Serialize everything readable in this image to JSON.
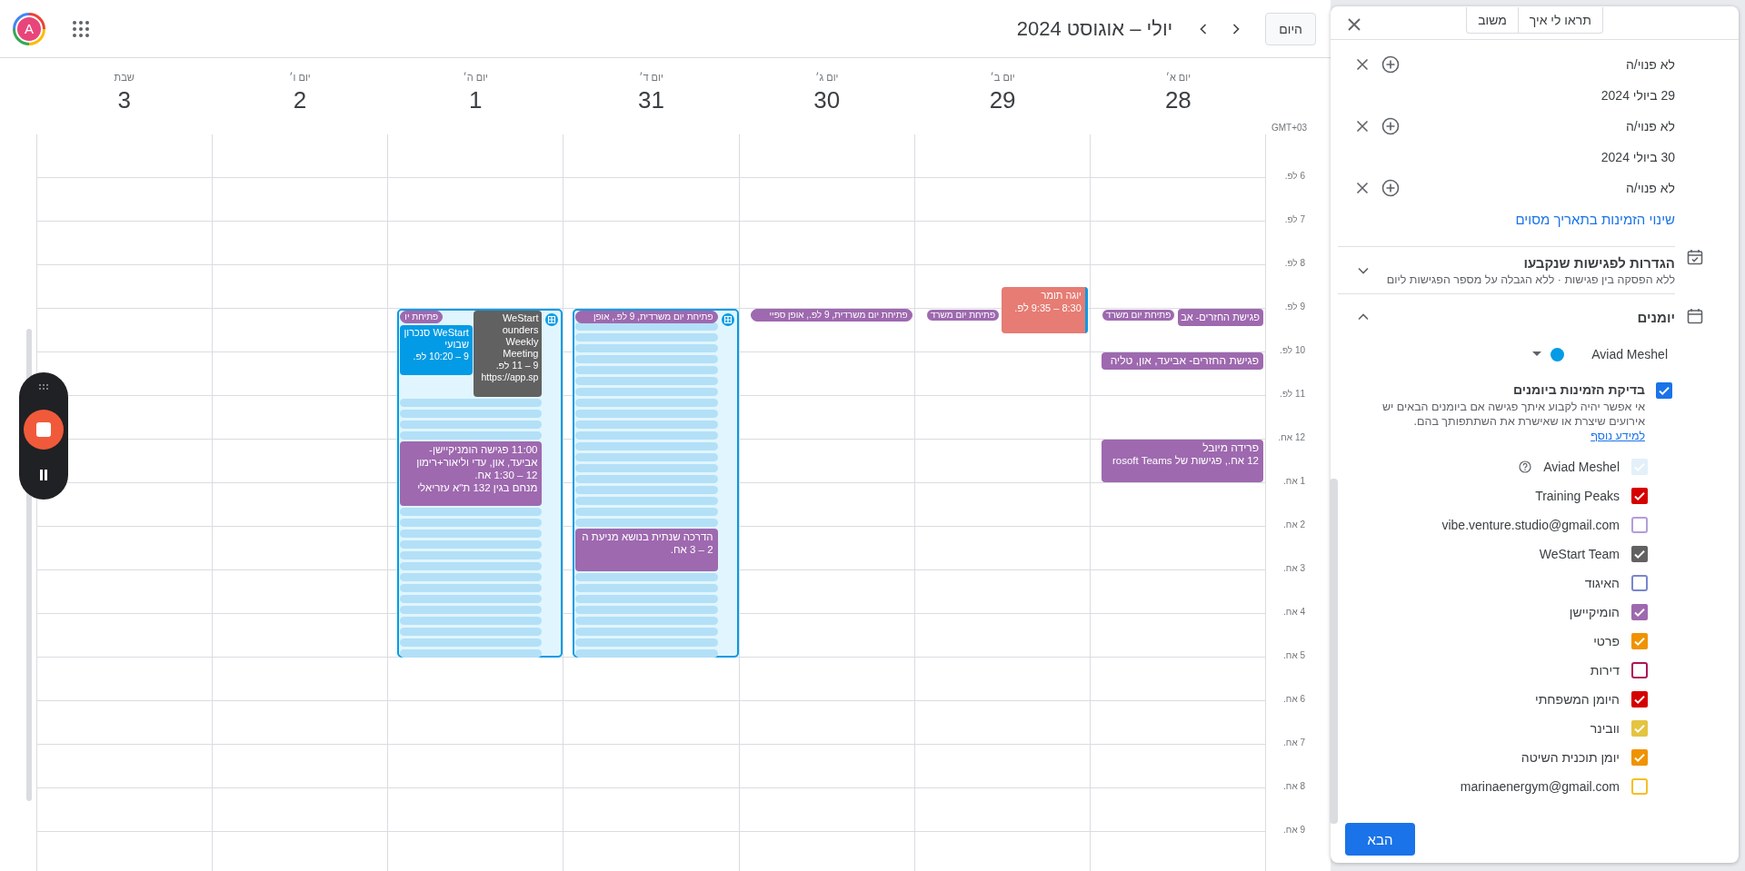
{
  "toolbar": {
    "today_button": "היום",
    "title": "יולי – אוגוסט 2024",
    "avatar_letter": "A"
  },
  "timezone": "GMT+03",
  "hours": [
    "6 לפ.",
    "7 לפ.",
    "8 לפ.",
    "9 לפ.",
    "10 לפ.",
    "11 לפ.",
    "12 אח.",
    "1 אח.",
    "2 אח.",
    "3 אח.",
    "4 אח.",
    "5 אח.",
    "6 אח.",
    "7 אח.",
    "8 אח.",
    "9 אח."
  ],
  "days": [
    {
      "weekday": "יום א׳",
      "date": "28",
      "selected": false,
      "events": [
        {
          "kind": "block",
          "title": "פגישת החזרים- אב",
          "color": "#9e69af"
        },
        {
          "kind": "chip",
          "title": "פתיחת יום משרד",
          "outlined": true,
          "color": "#9e69af"
        },
        {
          "kind": "block",
          "title": "פגישת החזרים- אביעד, און, טליה",
          "color": "#9e69af"
        },
        {
          "kind": "block",
          "title": "פרידה מיובל",
          "time": "12 אח., פגישות של rosoft Teams",
          "color": "#9e69af"
        }
      ]
    },
    {
      "weekday": "יום ב׳",
      "date": "29",
      "selected": false,
      "events": [
        {
          "kind": "block",
          "title": "יוגה תומר",
          "time": "8:30 – 9:35 לפ.",
          "color": "#e67c73",
          "accent": {
            "color": "#039be5"
          }
        },
        {
          "kind": "chip",
          "title": "פתיחת יום משרד",
          "outlined": true,
          "color": "#9e69af"
        }
      ]
    },
    {
      "weekday": "יום ג׳",
      "date": "30",
      "selected": false,
      "events": [
        {
          "kind": "chip",
          "title": "פתיחת יום משרדית, 9 לפ., אופן ספיי",
          "outlined": false,
          "color": "#9e69af"
        }
      ]
    },
    {
      "weekday": "יום ד׳",
      "date": "31",
      "selected": true,
      "events": [
        {
          "kind": "chip",
          "title": "פתיחת יום משרדית, 9 לפ., אופן",
          "outlined": false,
          "color": "#9e69af"
        },
        {
          "kind": "block",
          "title": "הדרכה שנתית בנושא מניעת ה",
          "time": "2 – 3 אח.",
          "color": "#9e69af"
        }
      ]
    },
    {
      "weekday": "יום ה׳",
      "date": "1",
      "selected": true,
      "events": [
        {
          "kind": "block",
          "title": "WeStart ounders Weekly Meeting",
          "time": "9 – 11 לפ.",
          "location": "https://app.sp",
          "color": "#616161"
        },
        {
          "kind": "chip",
          "title": "פתיחת יו",
          "outlined": false,
          "color": "#9e69af"
        },
        {
          "kind": "block",
          "title": "WeStart סנכרון שבועי",
          "time": "9 – 10:20 לפ.",
          "color": "#039be5"
        },
        {
          "kind": "block",
          "title": "11:00 פגישה הומניקיישן- אביעד, און, עדי וליאור+רימון",
          "time": "12 – 1:30 אח.",
          "location": "מנחם בגין 132 ת\"א עזריאלי",
          "color": "#9e69af"
        }
      ]
    },
    {
      "weekday": "יום ו׳",
      "date": "2",
      "selected": false
    },
    {
      "weekday": "שבת",
      "date": "3",
      "selected": false
    }
  ],
  "panel": {
    "header_buttons": [
      "תראו לי איך",
      "משוב"
    ],
    "availability": [
      {
        "kind": "status",
        "text": "לא פנוי/ה"
      },
      {
        "kind": "date",
        "text": "29 ביולי 2024"
      },
      {
        "kind": "status",
        "text": "לא פנוי/ה"
      },
      {
        "kind": "date",
        "text": "30 ביולי 2024"
      },
      {
        "kind": "status",
        "text": "לא פנוי/ה"
      }
    ],
    "change_link": "שינוי הזמינות בתאריך מסוים",
    "sections": [
      {
        "title": "הגדרות לפגישות שנקבעו",
        "subtitle": "ללא הפסקה בין פגישות · ללא הגבלה על מספר הפגישות ליום",
        "expanded": false
      },
      {
        "title": "יומנים",
        "expanded": true,
        "owner": {
          "name": "Aviad Meshel",
          "color": "#039be5"
        },
        "conflict_check": {
          "label": "בדיקת הזמינות ביומנים",
          "checked": true,
          "description": "אי אפשר יהיה לקבוע איתך פגישה אם ביומנים הבאים יש אירועים שיצרת או שאישרת את השתתפותך בהם.",
          "link": "למידע נוסף"
        },
        "calendars": [
          {
            "name": "Aviad Meshel",
            "checked": true,
            "disabled": true,
            "help": true
          },
          {
            "name": "Training Peaks",
            "checked": true,
            "disabled": false,
            "help": false,
            "color": "#d50000"
          },
          {
            "name": "vibe.venture.studio@gmail.com",
            "checked": false,
            "disabled": false,
            "help": false,
            "color": "#b39ddb"
          },
          {
            "name": "WeStart Team",
            "checked": true,
            "disabled": false,
            "help": false,
            "color": "#616161"
          },
          {
            "name": "האיגוד",
            "checked": false,
            "disabled": false,
            "help": false,
            "color": "#7986cb"
          },
          {
            "name": "הומיקיישן",
            "checked": true,
            "disabled": false,
            "help": false,
            "color": "#9e69af"
          },
          {
            "name": "פרטי",
            "checked": true,
            "disabled": false,
            "help": false,
            "color": "#f09300"
          },
          {
            "name": "דירות",
            "checked": false,
            "disabled": false,
            "help": false,
            "color": "#ad1457"
          },
          {
            "name": "היומן המשפחתי",
            "checked": true,
            "disabled": false,
            "help": false,
            "color": "#d50000"
          },
          {
            "name": "וובינר",
            "checked": true,
            "disabled": false,
            "help": false,
            "color": "#e4c441"
          },
          {
            "name": "יומן תוכנית השיטה",
            "checked": true,
            "disabled": false,
            "help": false,
            "color": "#f09300"
          },
          {
            "name": "marinaenergym@gmail.com",
            "checked": false,
            "disabled": false,
            "help": false,
            "color": "#f6bf26"
          }
        ]
      }
    ],
    "next_button": "הבא"
  }
}
